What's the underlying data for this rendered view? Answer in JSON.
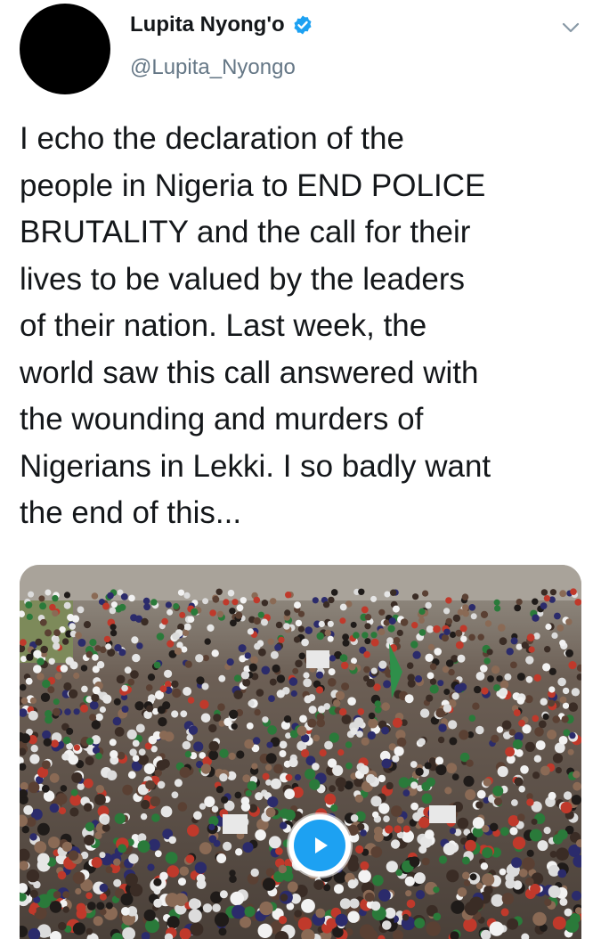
{
  "author": {
    "display_name": "Lupita Nyong'o",
    "handle": "@Lupita_Nyongo",
    "verified": true,
    "avatar": "black-circle"
  },
  "tweet": {
    "text": "I echo the declaration of the\npeople in Nigeria to END POLICE\nBRUTALITY and the call for their\nlives to be valued by the leaders\nof their nation. Last week, the\nworld saw this call answered with\nthe wounding and murders of\nNigerians in Lekki. I so badly want\nthe end of this..."
  },
  "media": {
    "type": "video",
    "content": "aerial crowd of protesters",
    "play_icon": "play-icon"
  },
  "icons": {
    "verified": "verified-badge-icon",
    "more": "chevron-down-icon"
  },
  "colors": {
    "accent": "#1da1f2",
    "text": "#14171a",
    "secondary_text": "#657786"
  }
}
